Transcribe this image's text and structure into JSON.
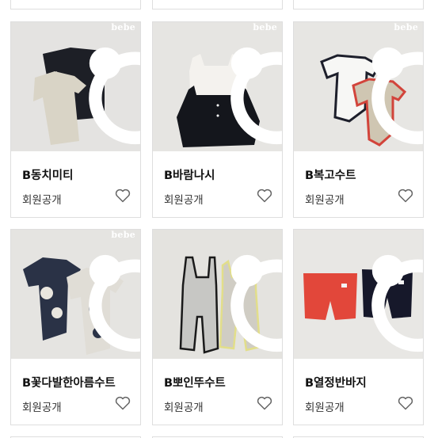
{
  "products": [
    {
      "brand": "bebe",
      "name": "B동치미티",
      "price": "회원공개",
      "icon": "heart-outline-icon"
    },
    {
      "brand": "bebe",
      "name": "B바람나시",
      "price": "회원공개",
      "icon": "heart-outline-icon"
    },
    {
      "brand": "bebe",
      "name": "B복고수트",
      "price": "회원공개",
      "icon": "heart-outline-icon"
    },
    {
      "brand": "bebe",
      "name": "B꽃다발한아름수트",
      "price": "회원공개",
      "icon": "heart-outline-icon"
    },
    {
      "brand": "",
      "name": "B뽀인뚜수트",
      "price": "회원공개",
      "icon": "heart-outline-icon"
    },
    {
      "brand": "",
      "name": "B열정반바지",
      "price": "회원공개",
      "icon": "heart-outline-icon"
    }
  ],
  "colors": {
    "border": "#dedede",
    "photo_bg": "#e9e9e9",
    "name_text": "#111111",
    "price_text": "#333333",
    "heart": "#666666"
  }
}
